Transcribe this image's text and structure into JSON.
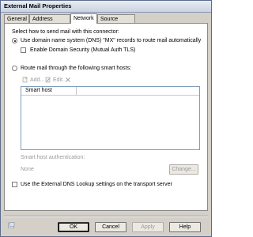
{
  "window": {
    "title": "External Mail Properties"
  },
  "tabs": [
    {
      "label": "General"
    },
    {
      "label": "Address Space"
    },
    {
      "label": "Network"
    },
    {
      "label": "Source Server"
    }
  ],
  "network": {
    "heading": "Select how to send mail with this connector:",
    "dns_option": "Use domain name system (DNS) \"MX\" records to route mail automatically",
    "tls_option": "Enable Domain Security (Mutual Auth TLS)",
    "smart_host_option": "Route mail through the following smart hosts:",
    "add_label": "Add...",
    "edit_label": "Edit...",
    "column_header": "Smart host",
    "auth_label": "Smart host authentication:",
    "auth_value": "None",
    "change_button": "Change...",
    "external_dns_option": "Use the External DNS Lookup settings on the transport server"
  },
  "buttons": {
    "ok": "OK",
    "cancel": "Cancel",
    "apply": "Apply",
    "help": "Help"
  },
  "state": {
    "selected_route": "dns",
    "tls_checked": false,
    "external_dns_checked": false
  }
}
